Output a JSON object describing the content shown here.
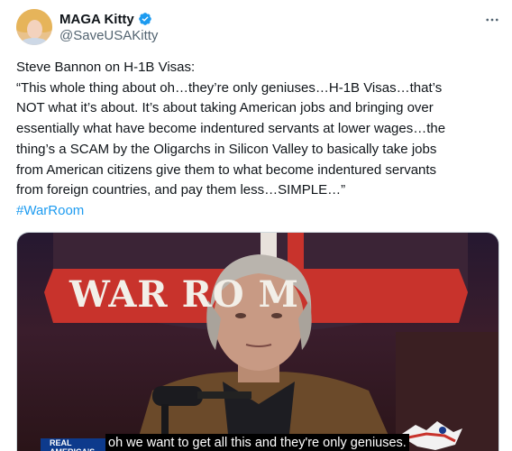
{
  "author": {
    "display_name": "MAGA Kitty",
    "handle": "@SaveUSAKitty",
    "verified": true
  },
  "icons": {
    "verified": "verified-badge-icon",
    "more": "more-options-icon"
  },
  "tweet": {
    "lines": [
      "Steve Bannon on H-1B Visas:",
      "“This whole thing about oh…they’re only geniuses…H-1B Visas…that’s",
      "NOT what it’s about. It’s about taking American jobs and bringing over",
      "essentially what have become indentured servants at lower wages…the",
      "thing’s a SCAM by the Oligarchs in Silicon Valley to basically take jobs",
      "from American citizens give them to what become indentured servants",
      "from foreign countries, and pay them less…SIMPLE…”"
    ],
    "hashtag": "#WarRoom"
  },
  "media": {
    "sign_text": "WAR RO M",
    "caption": "oh we want to get all this and they're only geniuses.",
    "network_logo_text": "REAL\nAMERICA'S"
  },
  "colors": {
    "accent": "#1d9bf0",
    "text": "#0f1419",
    "secondary": "#536471"
  }
}
